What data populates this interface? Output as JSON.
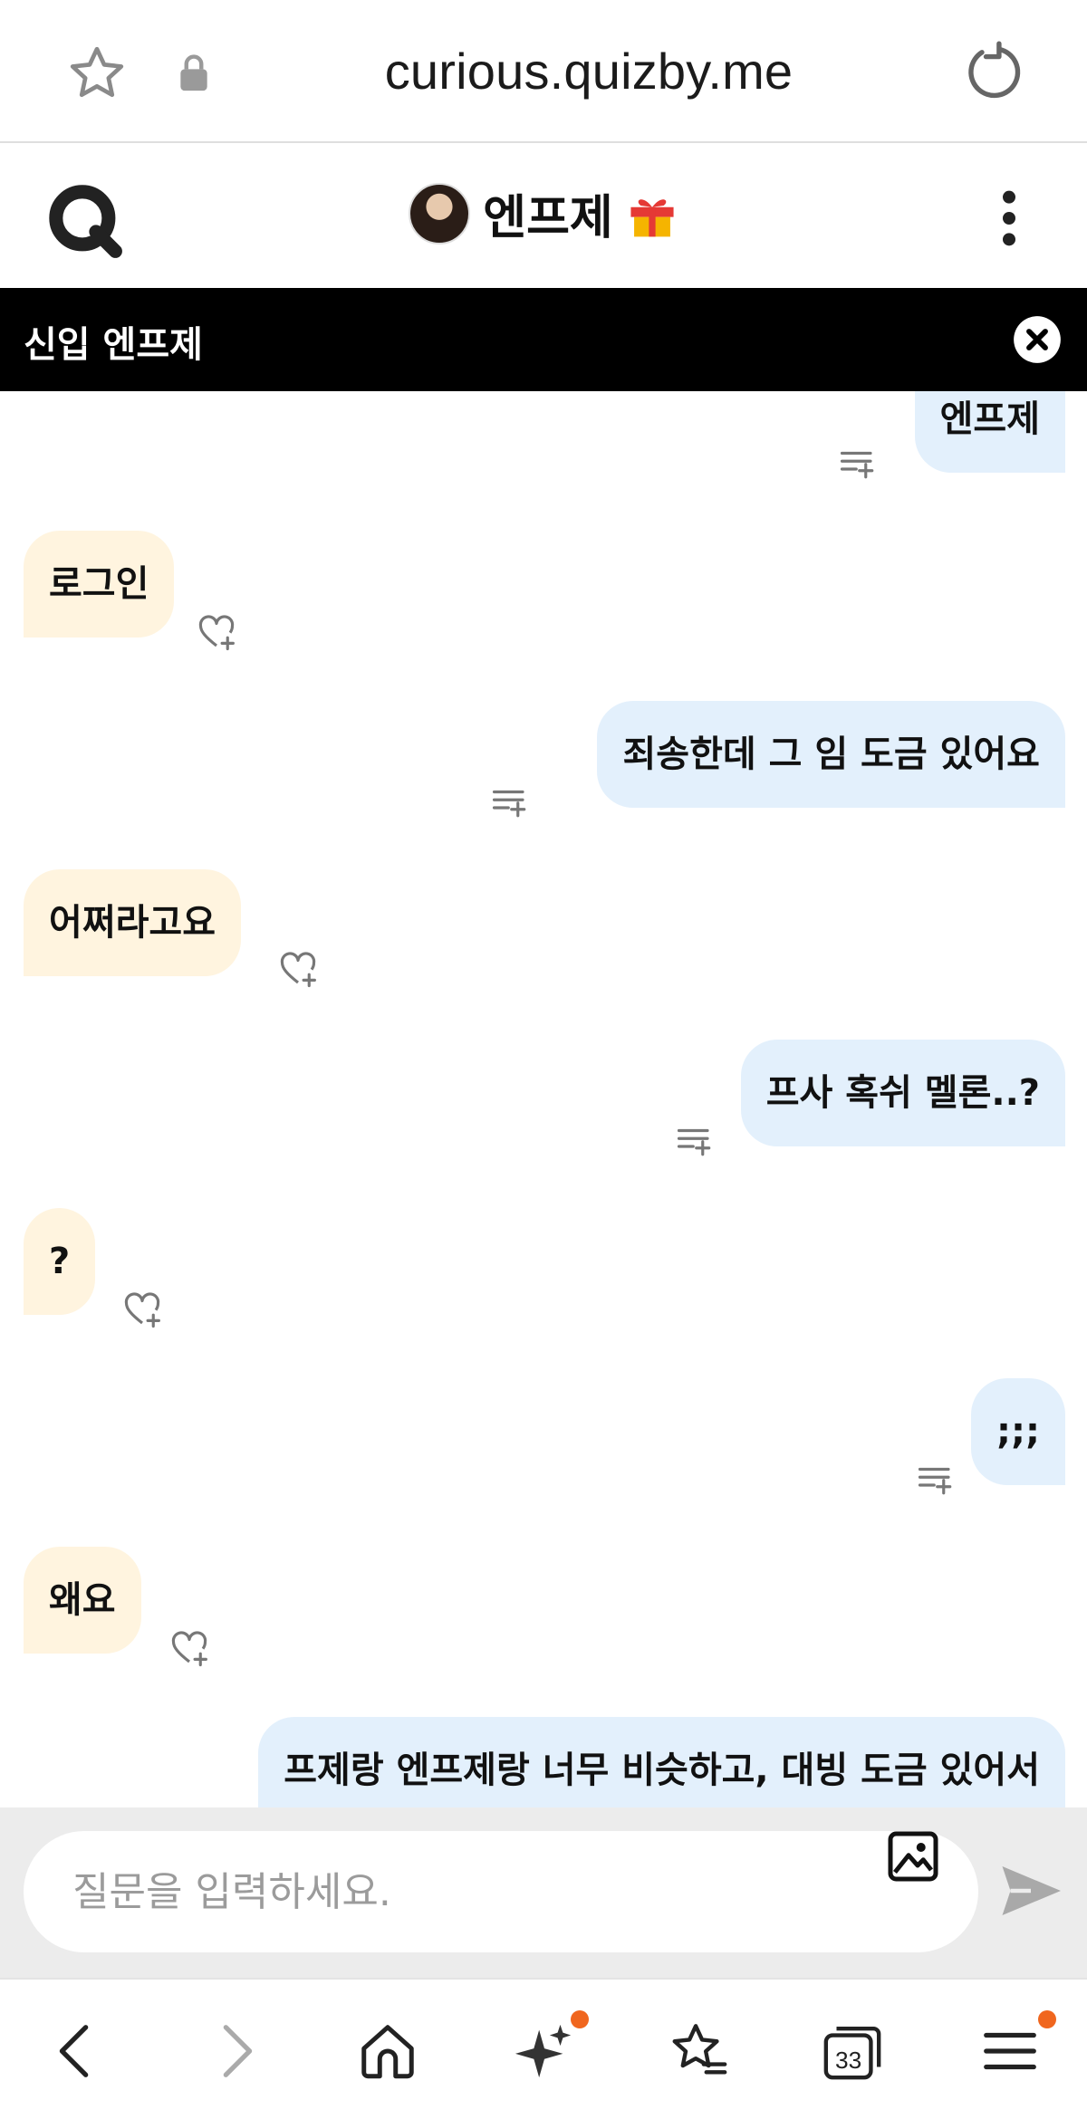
{
  "browser": {
    "url": "curious.quizby.me",
    "icons": [
      "star-icon",
      "lock-icon",
      "reload-icon"
    ]
  },
  "header": {
    "title": "엔프제",
    "title_emoji": "gift-icon",
    "logo": "quizby-logo",
    "menu_icon": "kebab-menu-icon"
  },
  "banner": {
    "text": "신입 엔프제",
    "close_icon": "close-circle-icon"
  },
  "messages": [
    {
      "side": "me",
      "text": "엔프제"
    },
    {
      "side": "them",
      "text": "로그인"
    },
    {
      "side": "me",
      "text": "죄송한데 그      임 도금 있어요"
    },
    {
      "side": "them",
      "text": "어쩌라고요"
    },
    {
      "side": "me",
      "text": "프사 혹쉬 멜론..?"
    },
    {
      "side": "them",
      "text": "?"
    },
    {
      "side": "me",
      "text": ";;;"
    },
    {
      "side": "them",
      "text": "왜요"
    },
    {
      "side": "me",
      "text": "프제랑 엔프제랑 너무 비슷하고, 대빙 도금 있어서"
    }
  ],
  "composer": {
    "placeholder": "질문을 입력하세요.",
    "value": ""
  },
  "bottom_nav": {
    "tab_count": "33",
    "items": [
      "back-icon",
      "forward-icon",
      "home-icon",
      "sparkle-icon",
      "bookmarks-icon",
      "tabs-icon",
      "menu-icon"
    ]
  },
  "colors": {
    "my_bubble": "#e3f0fc",
    "their_bubble": "#fff4df",
    "banner": "#000000",
    "notification_dot": "#f0661e"
  }
}
